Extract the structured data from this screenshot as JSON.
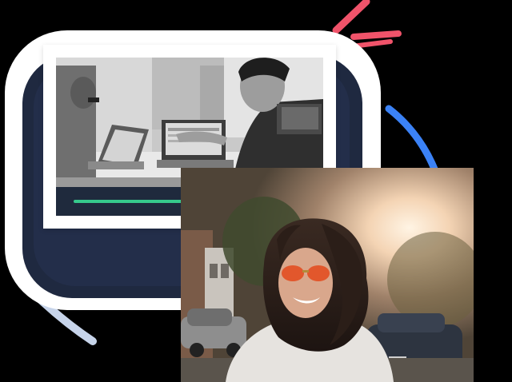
{
  "scene": {
    "description_free": true
  },
  "video_card": {
    "photo_icon": "office-meeting-photo",
    "progress": 0.68,
    "progress_color": "#36c98c",
    "bar_color": "#1f2a3d"
  },
  "portrait_card": {
    "photo_icon": "smiling-woman-sunglasses-photo"
  },
  "colors": {
    "frame": "#ffffff",
    "navy": "#1f2940",
    "accent_red": "#f0536a",
    "accent_blue": "#3b82f6",
    "accent_light_blue": "#c7d4ea"
  }
}
